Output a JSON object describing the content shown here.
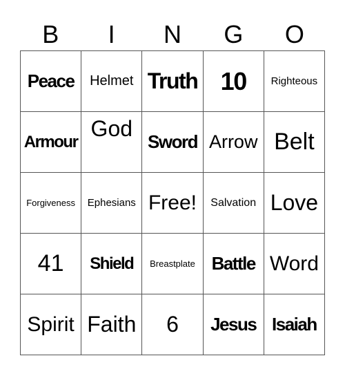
{
  "header": [
    "B",
    "I",
    "N",
    "G",
    "O"
  ],
  "cells": [
    "Peace",
    "Helmet",
    "Truth",
    "10",
    "Righteous",
    "Armour",
    "God",
    "Sword",
    "Arrow",
    "Belt",
    "Forgiveness",
    "Ephesians",
    "Free!",
    "Salvation",
    "Love",
    "41",
    "Shield",
    "Breastplate",
    "Battle",
    "Word",
    "Spirit",
    "Faith",
    "6",
    "Jesus",
    "Isaiah"
  ]
}
